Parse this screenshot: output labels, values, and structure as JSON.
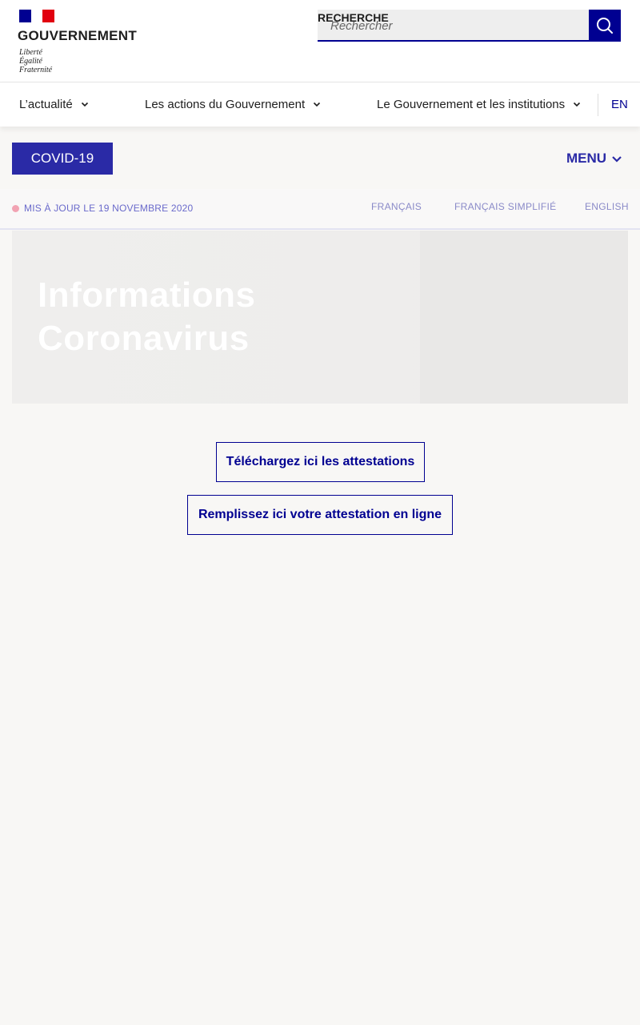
{
  "header": {
    "gov_name": "GOUVERNEMENT",
    "motto": [
      "Liberté",
      "Égalité",
      "Fraternité"
    ],
    "search_label": "RECHERCHE",
    "search_placeholder": "Rechercher",
    "search_value": "",
    "search_icon": "search-icon",
    "flag_colors": {
      "blue": "#000091",
      "white": "#ffffff",
      "red": "#e1000f"
    }
  },
  "nav": {
    "items": [
      {
        "label": "L’actualité"
      },
      {
        "label": "Les actions du Gouvernement"
      },
      {
        "label": "Le Gouvernement et les institutions"
      }
    ],
    "lang_switch": "EN"
  },
  "covid_bar": {
    "covid_label": "COVID-19",
    "menu_label": "MENU"
  },
  "info_bar": {
    "update_text": "MIS À JOUR LE 19 NOVEMBRE 2020",
    "languages": [
      "FRANÇAIS",
      "FRANÇAIS SIMPLIFIÉ",
      "ENGLISH"
    ]
  },
  "hero": {
    "title_line1": "Informations",
    "title_line2": "Coronavirus"
  },
  "actions": {
    "download_label": "Téléchargez ici les attestations",
    "fill_label": "Remplissez ici votre attestation en ligne"
  },
  "colors": {
    "accent": "#000091",
    "covid_button": "#2a2aa6",
    "update_dot": "#f2a3b3",
    "page_background": "#f8f7f5"
  }
}
